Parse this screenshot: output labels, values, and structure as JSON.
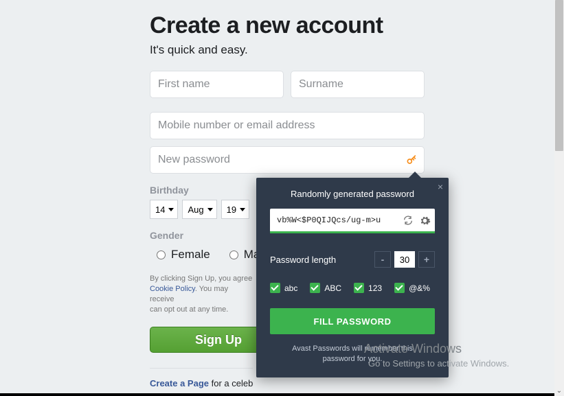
{
  "heading": "Create a new account",
  "subtitle": "It's quick and easy.",
  "firstname_placeholder": "First name",
  "surname_placeholder": "Surname",
  "contact_placeholder": "Mobile number or email address",
  "password_placeholder": "New password",
  "birthday_label": "Birthday",
  "bday_day": "14",
  "bday_month": "Aug",
  "bday_year": "19",
  "gender_label": "Gender",
  "gender_female": "Female",
  "gender_male": "Ma",
  "legal_prefix": "By clicking Sign Up, you agree",
  "legal_cookie": "Cookie Policy",
  "legal_middle": ". You may receive",
  "legal_opt": "can opt out at any time.",
  "signup_label": "Sign Up",
  "create_page_link": "Create a Page",
  "create_page_rest": " for a celeb",
  "popup": {
    "title": "Randomly generated password",
    "generated": "vb%W<$P0QIJQcs/ug-m>u",
    "length_label": "Password length",
    "length_value": "30",
    "minus": "-",
    "plus": "+",
    "opt_abc": "abc",
    "opt_ABC": "ABC",
    "opt_123": "123",
    "opt_sym": "@&%",
    "fill_label": "FILL PASSWORD",
    "remember_l1": "Avast Passwords will remember this",
    "remember_l2": "password for you."
  },
  "watermark": {
    "l1": "Activate Windows",
    "l2": "Go to Settings to activate Windows."
  }
}
